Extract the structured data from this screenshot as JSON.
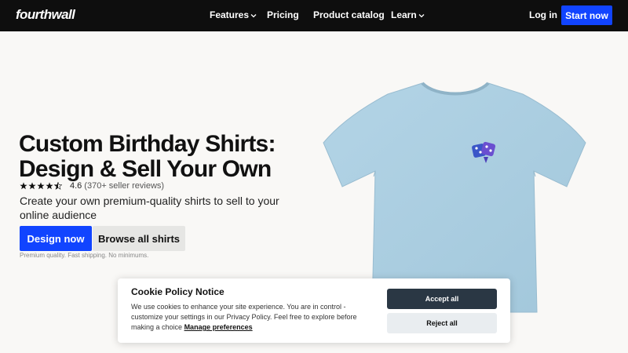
{
  "nav": {
    "logo": "fourthwall",
    "items": [
      {
        "label": "Features",
        "has_dropdown": true
      },
      {
        "label": "Pricing",
        "has_dropdown": false
      },
      {
        "label": "Product catalog",
        "has_dropdown": false
      },
      {
        "label": "Learn",
        "has_dropdown": true
      }
    ],
    "login": "Log in",
    "cta": "Start now"
  },
  "hero": {
    "title_line1": "Custom Birthday Shirts:",
    "title_line2": "Design & Sell Your Own",
    "rating": {
      "value": "4.6",
      "reviews": "(370+ seller reviews)",
      "stars": 4.5
    },
    "subtitle": "Create your own premium-quality shirts to sell to your online audience",
    "primary_button": "Design now",
    "secondary_button": "Browse all shirts",
    "fine_print": "Premium quality. Fast shipping. No minimums."
  },
  "product": {
    "shirt_color": "#a9cde0",
    "graphic": "dice-icon"
  },
  "cookie": {
    "title": "Cookie Policy Notice",
    "text": "We use cookies to enhance your site experience. You are in control - customize your settings in our Privacy Policy. Feel free to explore before making a choice",
    "link": "Manage preferences",
    "accept": "Accept all",
    "reject": "Reject all"
  },
  "colors": {
    "accent": "#1144ff",
    "nav_bg": "#0e0e0e",
    "accept_bg": "#2a3744"
  }
}
